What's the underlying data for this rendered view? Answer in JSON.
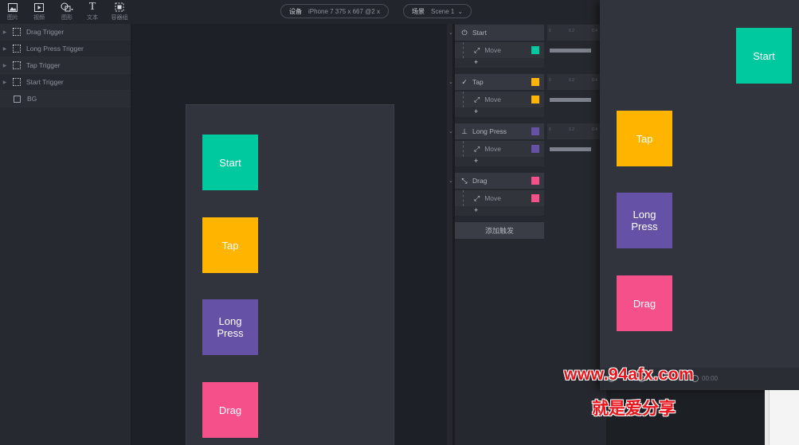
{
  "toolbar": {
    "tools": [
      {
        "label": "图片",
        "icon": "image-icon"
      },
      {
        "label": "视频",
        "icon": "video-icon"
      },
      {
        "label": "图形",
        "icon": "shape-icon"
      },
      {
        "label": "文本",
        "icon": "text-icon"
      },
      {
        "label": "容器组",
        "icon": "container-icon"
      }
    ],
    "device": {
      "key": "设备",
      "value": "iPhone 7  375 x 667  @2 x"
    },
    "scene": {
      "key": "场景",
      "value": "Scene 1"
    }
  },
  "layers": [
    {
      "name": "Drag Trigger",
      "icon": "group-icon"
    },
    {
      "name": "Long Press Trigger",
      "icon": "group-icon"
    },
    {
      "name": "Tap Trigger",
      "icon": "group-icon"
    },
    {
      "name": "Start Trigger",
      "icon": "group-icon"
    },
    {
      "name": "BG",
      "icon": "rectangle-icon"
    }
  ],
  "canvas": {
    "boxes": [
      {
        "label": "Start",
        "color": "#00c9a0"
      },
      {
        "label": "Tap",
        "color": "#ffb400"
      },
      {
        "label": "Long\nPress",
        "color": "#6552a6"
      },
      {
        "label": "Drag",
        "color": "#f5508a"
      }
    ]
  },
  "triggers": [
    {
      "name": "Start",
      "icon": "power-icon",
      "action": "Move",
      "color": "#00c9a0",
      "has_swatch": false
    },
    {
      "name": "Tap",
      "icon": "tap-icon",
      "action": "Move",
      "color": "#ffb400",
      "has_swatch": true
    },
    {
      "name": "Long Press",
      "icon": "long-press-icon",
      "action": "Move",
      "color": "#6552a6",
      "has_swatch": true
    },
    {
      "name": "Drag",
      "icon": "drag-icon",
      "action": "Move",
      "color": "#f5508a",
      "has_swatch": true
    }
  ],
  "trigger_add": "+",
  "add_trigger_label": "添加触发",
  "ruler_ticks": [
    "0",
    "0.2",
    "0.4"
  ],
  "preview": {
    "boxes": [
      {
        "label": "Start"
      },
      {
        "label": "Tap"
      },
      {
        "label": "Long\nPress"
      },
      {
        "label": "Drag"
      }
    ],
    "time": "00:00"
  },
  "watermark": {
    "line1": "www.94afx.com",
    "line2": "就是爱分享"
  }
}
